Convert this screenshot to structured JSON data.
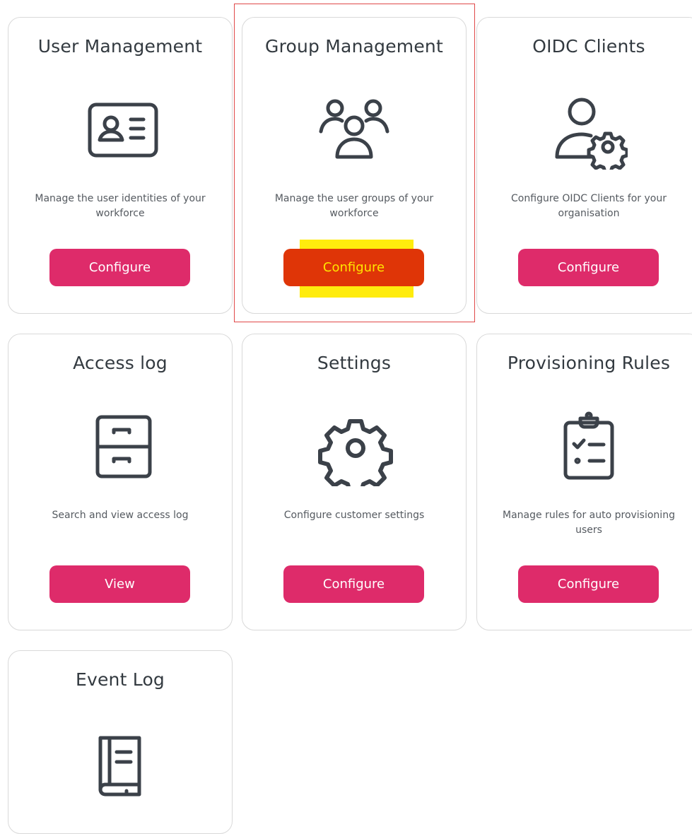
{
  "cards": [
    {
      "title": "User Management",
      "icon": "id-card-icon",
      "description": "Manage the user identities of your workforce",
      "button": "Configure"
    },
    {
      "title": "Group Management",
      "icon": "user-group-icon",
      "description": "Manage the user groups of your workforce",
      "button": "Configure"
    },
    {
      "title": "OIDC Clients",
      "icon": "user-gear-icon",
      "description": "Configure OIDC Clients for your organisation",
      "button": "Configure"
    },
    {
      "title": "Access log",
      "icon": "file-cabinet-icon",
      "description": "Search and view access log",
      "button": "View"
    },
    {
      "title": "Settings",
      "icon": "gear-icon",
      "description": "Configure customer settings",
      "button": "Configure"
    },
    {
      "title": "Provisioning Rules",
      "icon": "clipboard-checklist-icon",
      "description": "Manage rules for auto provisioning users",
      "button": "Configure"
    },
    {
      "title": "Event Log",
      "icon": "book-icon",
      "description": "",
      "button": ""
    }
  ],
  "colors": {
    "button": "#de2b6a",
    "button_text": "#ffffff",
    "icon_stroke": "#3b4149",
    "card_border": "#d9d9d9",
    "annotation_box": "#e04848",
    "annotation_marker": "#ffeb00"
  }
}
